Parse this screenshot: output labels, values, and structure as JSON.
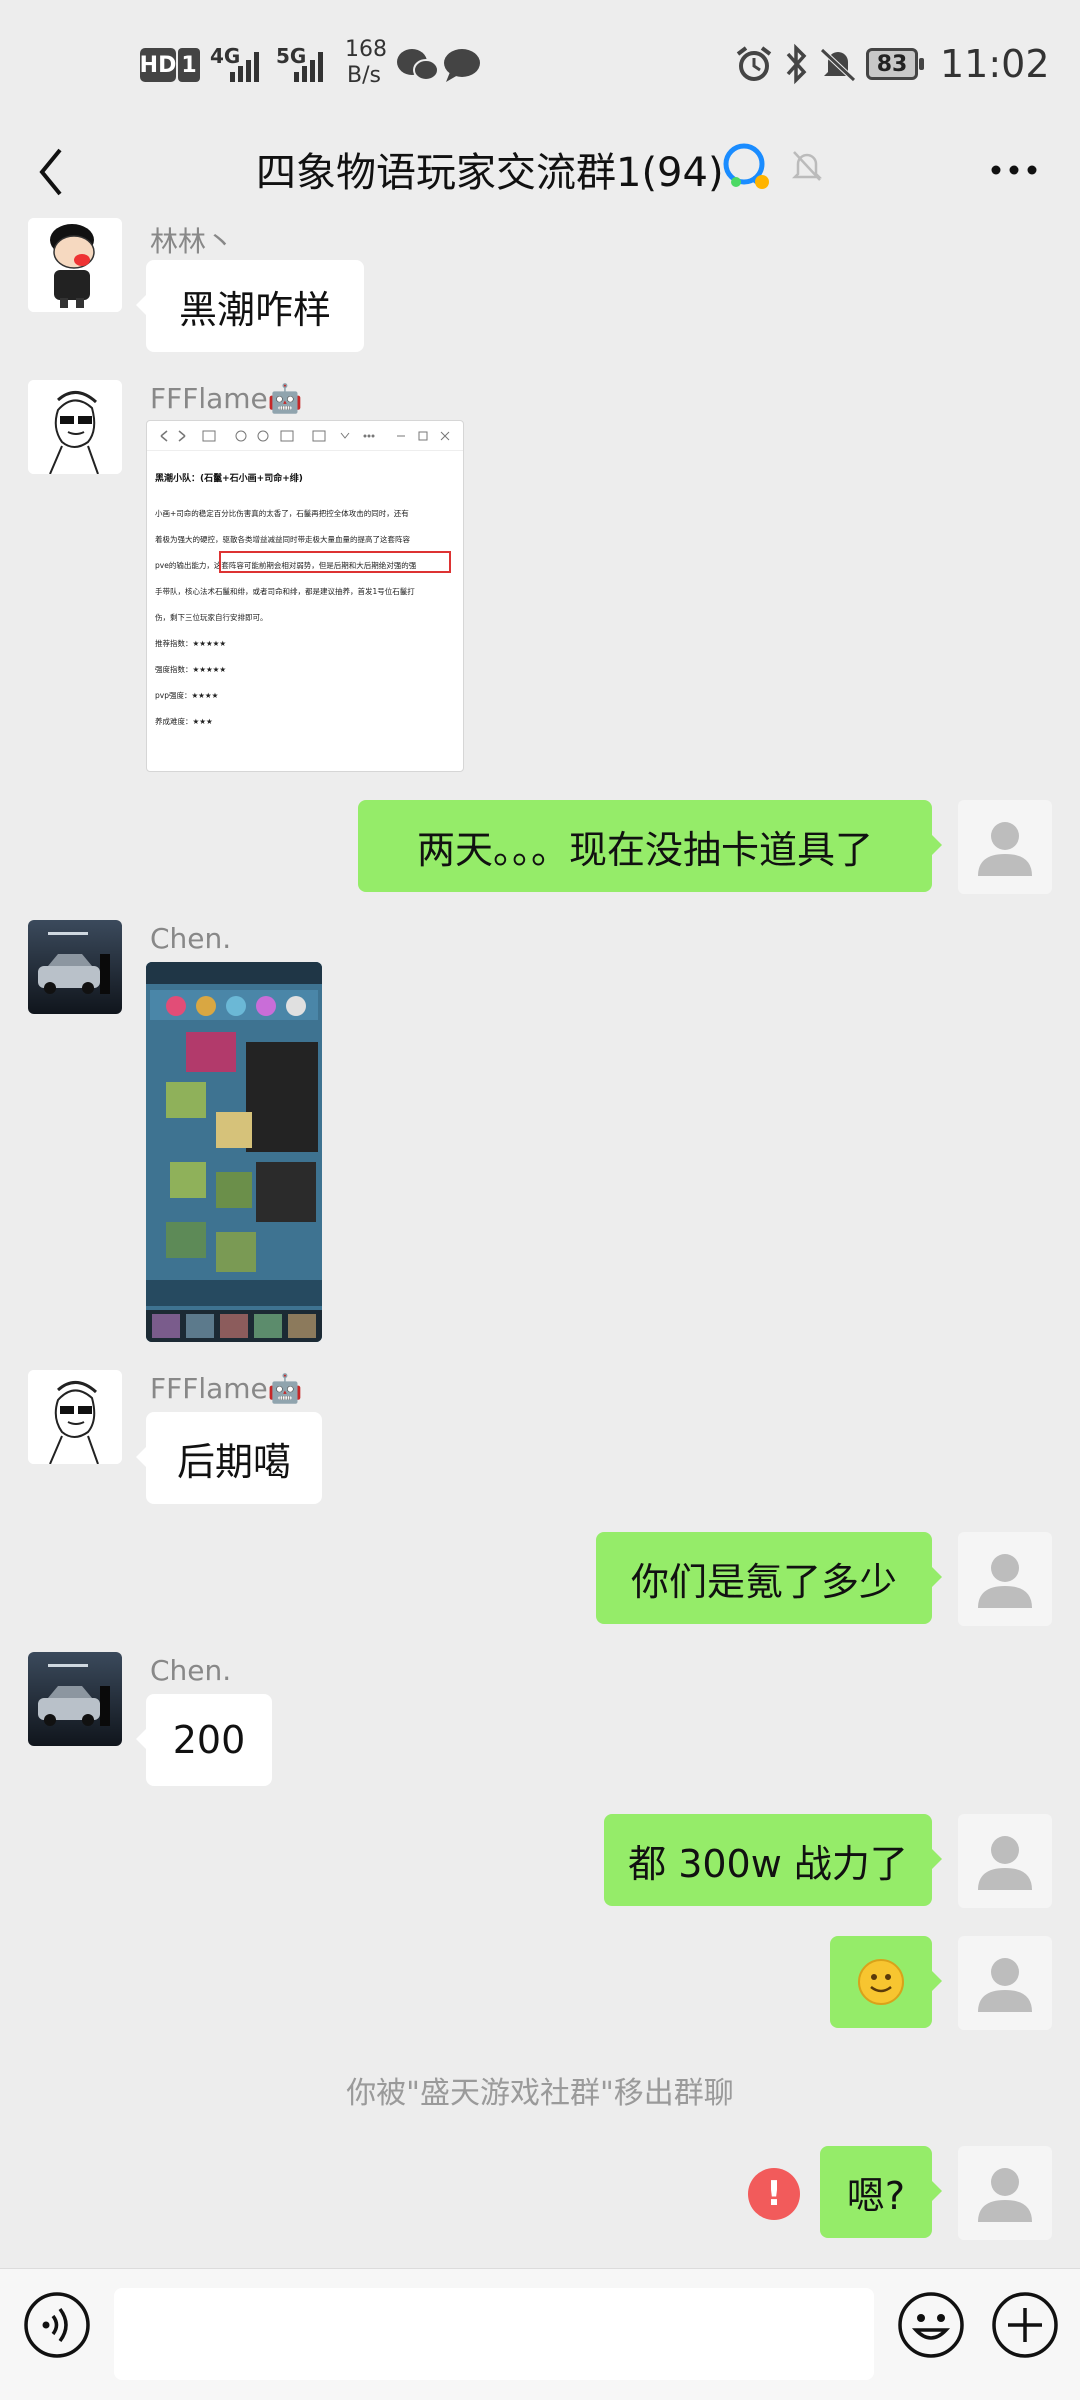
{
  "status_bar": {
    "network": "HD",
    "sim": "1",
    "signal1": "4G",
    "signal2": "5G",
    "speed_value": "168",
    "speed_unit": "B/s",
    "battery": "83",
    "time": "11:02"
  },
  "header": {
    "title": "四象物语玩家交流群1(94)"
  },
  "messages": {
    "m1": {
      "sender": "林林丶",
      "text": "黑潮咋样"
    },
    "m2": {
      "sender": "FFFlame🤖",
      "doc_title": "黑潮小队：(石鬣+石小画+司命+绯)",
      "doc_lines": [
        "小画+司命的稳定百分比伤害真的太香了，石鬣再把控全体攻击的同时，还有",
        "着极为强大的硬控，驱散各类增益减益同时带走极大量血量的提高了这套阵容",
        "pve的输出能力，这套阵容可能前期会相对弱势，但是后期和大后期绝对强的强",
        "手带队，核心法术石鬣和绯，或者司命和绯，都是建议抽养，首发1号位石鬣打",
        "伤，剩下三位玩家自行安排即可。"
      ],
      "doc_ratings": [
        "推荐指数：★★★★★",
        "强度指数：★★★★★",
        "pvp强度：★★★★",
        "养成难度：★★★"
      ]
    },
    "m3": {
      "text": "两天。。。现在没抽卡道具了"
    },
    "m4": {
      "sender": "Chen."
    },
    "m5": {
      "sender": "FFFlame🤖",
      "text": "后期噶"
    },
    "m6": {
      "text": "你们是氪了多少"
    },
    "m7": {
      "sender": "Chen.",
      "text": "200"
    },
    "m8": {
      "text": "都 300w 战力了"
    },
    "m9": {
      "text": "🙂"
    },
    "m10": {
      "text": "嗯?"
    }
  },
  "system_message": "你被\"盛天游戏社群\"移出群聊",
  "error_mark": "!",
  "colors": {
    "background": "#ededed",
    "outgoing_bubble": "#95ec69",
    "incoming_bubble": "#ffffff",
    "error_red": "#f25b5b"
  }
}
